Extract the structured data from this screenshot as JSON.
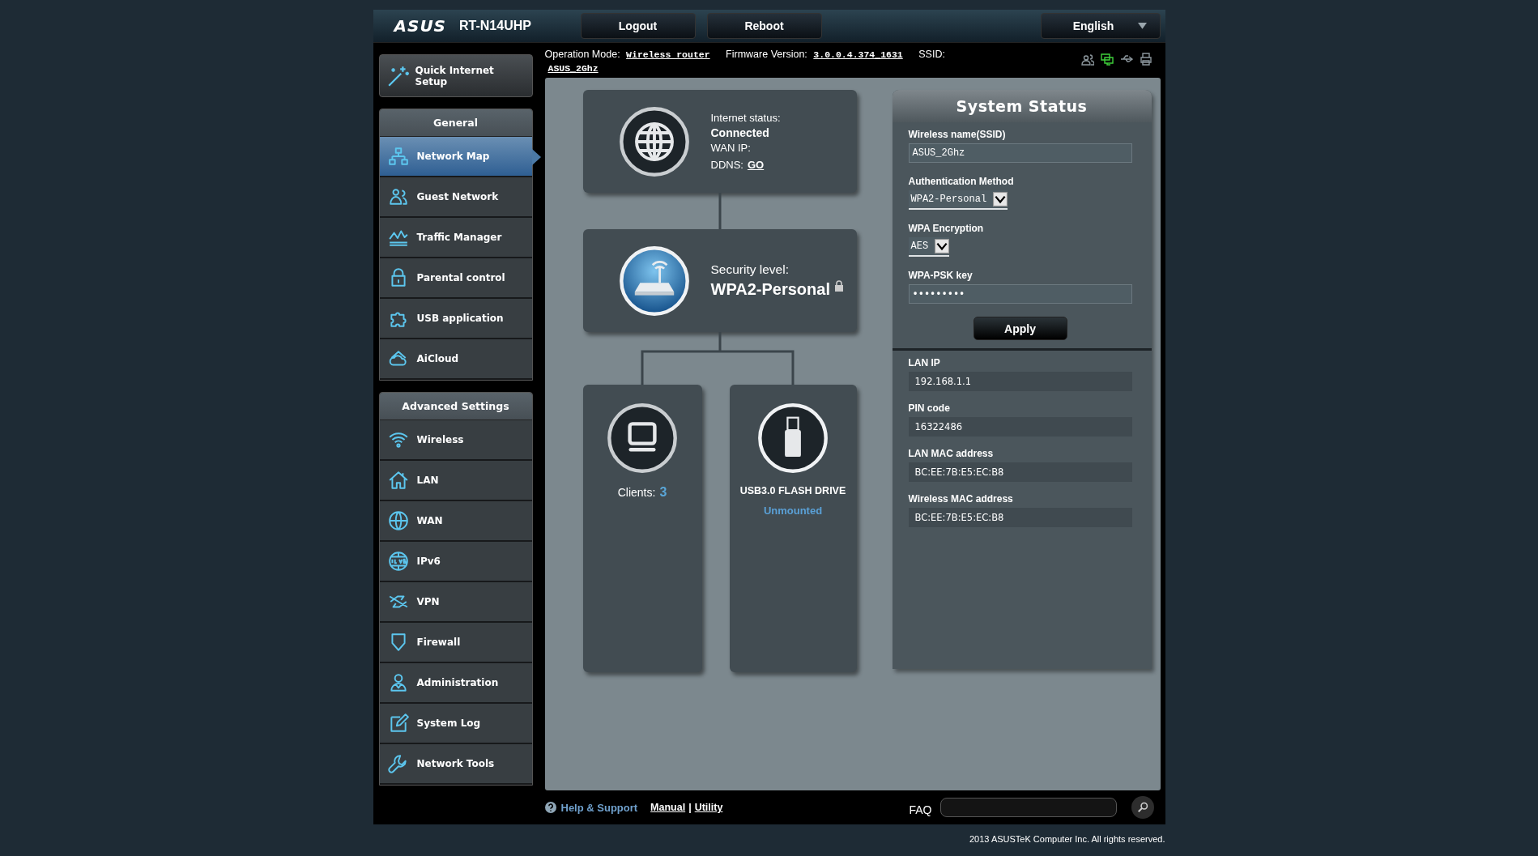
{
  "header": {
    "logo": "ASUS",
    "model": "RT-N14UHP",
    "buttons": [
      "Logout",
      "Reboot"
    ],
    "language": "English"
  },
  "info_bar": {
    "operation_mode_label": "Operation Mode:",
    "operation_mode": "Wireless router",
    "firmware_label": "Firmware Version:",
    "firmware": "3.0.0.4.374_1631",
    "ssid_label": "SSID:",
    "ssid": "ASUS_2Ghz",
    "status_icons": [
      {
        "kind": "users",
        "active": false
      },
      {
        "kind": "monitor",
        "active": true
      },
      {
        "kind": "usb",
        "active": false
      },
      {
        "kind": "printer",
        "active": false
      }
    ]
  },
  "sidebar": {
    "quick_setup": "Quick Internet Setup",
    "sections": [
      {
        "title": "General",
        "items": [
          {
            "label": "Network Map",
            "kind": "network",
            "selected": true
          },
          {
            "label": "Guest Network",
            "kind": "guest",
            "selected": false
          },
          {
            "label": "Traffic Manager",
            "kind": "traffic",
            "selected": false
          },
          {
            "label": "Parental control",
            "kind": "lock",
            "selected": false
          },
          {
            "label": "USB application",
            "kind": "puzzle",
            "selected": false
          },
          {
            "label": "AiCloud",
            "kind": "cloud",
            "selected": false
          }
        ]
      },
      {
        "title": "Advanced Settings",
        "items": [
          {
            "label": "Wireless",
            "kind": "wifi",
            "selected": false
          },
          {
            "label": "LAN",
            "kind": "house",
            "selected": false
          },
          {
            "label": "WAN",
            "kind": "globe",
            "selected": false
          },
          {
            "label": "IPv6",
            "kind": "ipv6",
            "selected": false
          },
          {
            "label": "VPN",
            "kind": "vpn",
            "selected": false
          },
          {
            "label": "Firewall",
            "kind": "shield",
            "selected": false
          },
          {
            "label": "Administration",
            "kind": "person",
            "selected": false
          },
          {
            "label": "System Log",
            "kind": "edit",
            "selected": false
          },
          {
            "label": "Network Tools",
            "kind": "wrench",
            "selected": false
          }
        ]
      }
    ]
  },
  "network_map": {
    "internet": {
      "status_label": "Internet status:",
      "status": "Connected",
      "wan_ip_label": "WAN IP:",
      "ddns_label": "DDNS:",
      "ddns_link": "GO"
    },
    "router": {
      "security_label": "Security level:",
      "security": "WPA2-Personal"
    },
    "clients": {
      "label": "Clients:",
      "count": "3"
    },
    "usb": {
      "device": "USB3.0 FLASH DRIVE",
      "status": "Unmounted"
    }
  },
  "system_status": {
    "title": "System Status",
    "fields": [
      {
        "kind": "text",
        "label": "Wireless name(SSID)",
        "value": "ASUS_2Ghz"
      },
      {
        "kind": "select",
        "label": "Authentication Method",
        "value": "WPA2-Personal"
      },
      {
        "kind": "select",
        "label": "WPA Encryption",
        "value": "AES"
      },
      {
        "kind": "password",
        "label": "WPA-PSK key",
        "value": "•••••••••"
      }
    ],
    "apply": "Apply",
    "info": [
      {
        "label": "LAN IP",
        "value": "192.168.1.1"
      },
      {
        "label": "PIN code",
        "value": "16322486"
      },
      {
        "label": "LAN MAC address",
        "value": "BC:EE:7B:E5:EC:B8"
      },
      {
        "label": "Wireless MAC address",
        "value": "BC:EE:7B:E5:EC:B8"
      }
    ]
  },
  "footer": {
    "help": "Help & Support",
    "links": [
      "Manual",
      "Utility"
    ],
    "separator": "|",
    "faq_label": "FAQ",
    "copyright": "2013 ASUSTeK Computer Inc. All rights reserved."
  }
}
